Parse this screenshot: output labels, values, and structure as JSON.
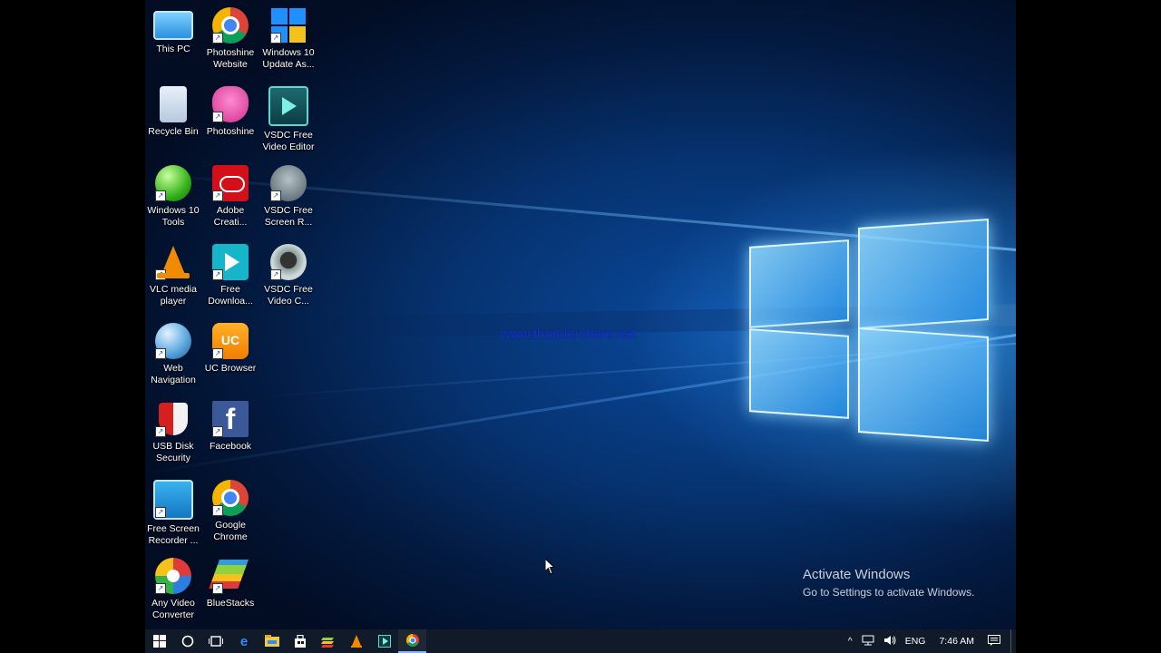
{
  "desktop": {
    "icons": [
      {
        "label": "This PC"
      },
      {
        "label": "Photoshine Website"
      },
      {
        "label": "Windows 10 Update As..."
      },
      {
        "label": "Recycle Bin"
      },
      {
        "label": "Photoshine"
      },
      {
        "label": "VSDC Free Video Editor"
      },
      {
        "label": "Windows 10 Tools"
      },
      {
        "label": "Adobe Creati..."
      },
      {
        "label": "VSDC Free Screen R..."
      },
      {
        "label": "VLC media player"
      },
      {
        "label": "Free Downloa..."
      },
      {
        "label": "VSDC Free Video C..."
      },
      {
        "label": "Web Navigation"
      },
      {
        "label": "UC Browser"
      },
      {
        "label": "USB Disk Security"
      },
      {
        "label": "Facebook"
      },
      {
        "label": "Free Screen Recorder ..."
      },
      {
        "label": "Google Chrome"
      },
      {
        "label": "Any Video Converter"
      },
      {
        "label": "BlueStacks"
      }
    ],
    "watermark": "www.thundershare.net",
    "activation": {
      "title": "Activate Windows",
      "subtitle": "Go to Settings to activate Windows."
    }
  },
  "taskbar": {
    "buttons": [
      {
        "icon": "windows-start-icon"
      },
      {
        "icon": "search-circle-icon"
      },
      {
        "icon": "task-view-icon"
      },
      {
        "icon": "edge-icon"
      },
      {
        "icon": "file-explorer-icon"
      },
      {
        "icon": "store-icon"
      },
      {
        "icon": "bluestacks-icon"
      },
      {
        "icon": "vlc-icon"
      },
      {
        "icon": "vsdc-icon"
      },
      {
        "icon": "chrome-icon"
      }
    ],
    "tray": {
      "chevron": "^",
      "language": "ENG",
      "time": "7:46 AM"
    }
  },
  "colors": {
    "taskbar_bg": "#101a28",
    "watermark": "#1630d8",
    "wallpaper_blue": "#0a4a9e"
  }
}
